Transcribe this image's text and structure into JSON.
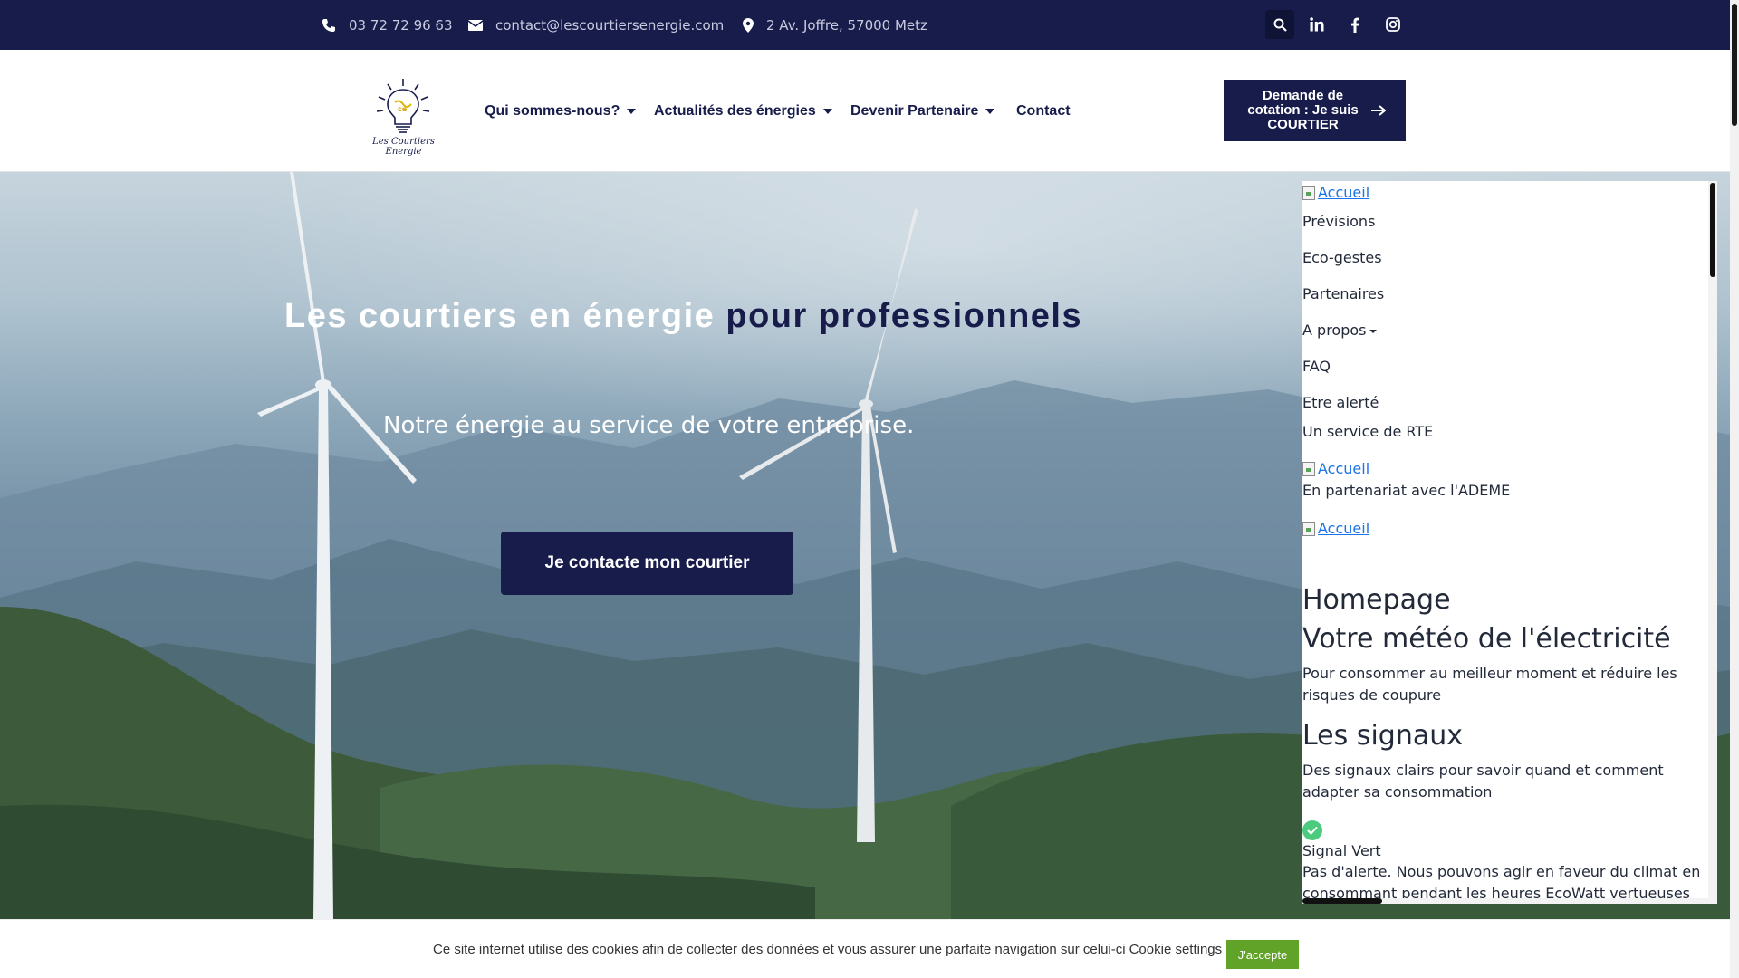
{
  "topbar": {
    "phone": "03 72 72 96 63",
    "email": "contact@lescourtiersenergie.com",
    "address": "2 Av. Joffre, 57000 Metz",
    "icons": [
      "search-icon",
      "linkedin-icon",
      "facebook-icon",
      "instagram-icon"
    ]
  },
  "header": {
    "logo_text": "Les Courtiers Energie",
    "nav": [
      {
        "label": "Qui sommes-nous?",
        "dropdown": true
      },
      {
        "label": "Actualités des énergies",
        "dropdown": true
      },
      {
        "label": "Devenir Partenaire",
        "dropdown": true
      },
      {
        "label": "Contact",
        "dropdown": false
      }
    ],
    "cta_label": "Demande de cotation : Je suis COURTIER"
  },
  "hero": {
    "title_part1": "Les courtiers en énergie",
    "title_part2": "pour professionnels",
    "subtitle": "Notre énergie au service de votre entreprise.",
    "button_label": "Je contacte mon courtier"
  },
  "widget": {
    "image_alt_1": "Accueil",
    "menu": [
      "Prévisions",
      "Eco-gestes",
      "Partenaires",
      "A propos",
      "FAQ",
      "Etre alerté"
    ],
    "rte_text": "Un service de RTE",
    "image_alt_2": "Accueil",
    "ademe_text": "En partenariat avec l'ADEME",
    "image_alt_3": "Accueil",
    "heading_homepage": "Homepage",
    "heading_meteo": "Votre météo de l'électricité",
    "meteo_text": "Pour consommer au meilleur moment et réduire les risques de coupure",
    "heading_signaux": "Les signaux",
    "signaux_text": "Des signaux clairs pour savoir quand et comment adapter sa consommation",
    "signal_vert_label": "Signal Vert",
    "signal_vert_text": "Pas d'alerte. Nous pouvons agir en faveur du climat en consommant pendant les heures EcoWatt vertueuses"
  },
  "cookie": {
    "text": "Ce site internet utilise des cookies afin de collecter des données et vous assurer une parfaite navigation sur celui-ci",
    "settings_label": "Cookie settings",
    "accept_label": "J'accepte"
  },
  "colors": {
    "navy": "#171c4b",
    "accept_green": "#61a229",
    "signal_green": "#4ccb7f",
    "link_blue": "#1a73e8"
  }
}
